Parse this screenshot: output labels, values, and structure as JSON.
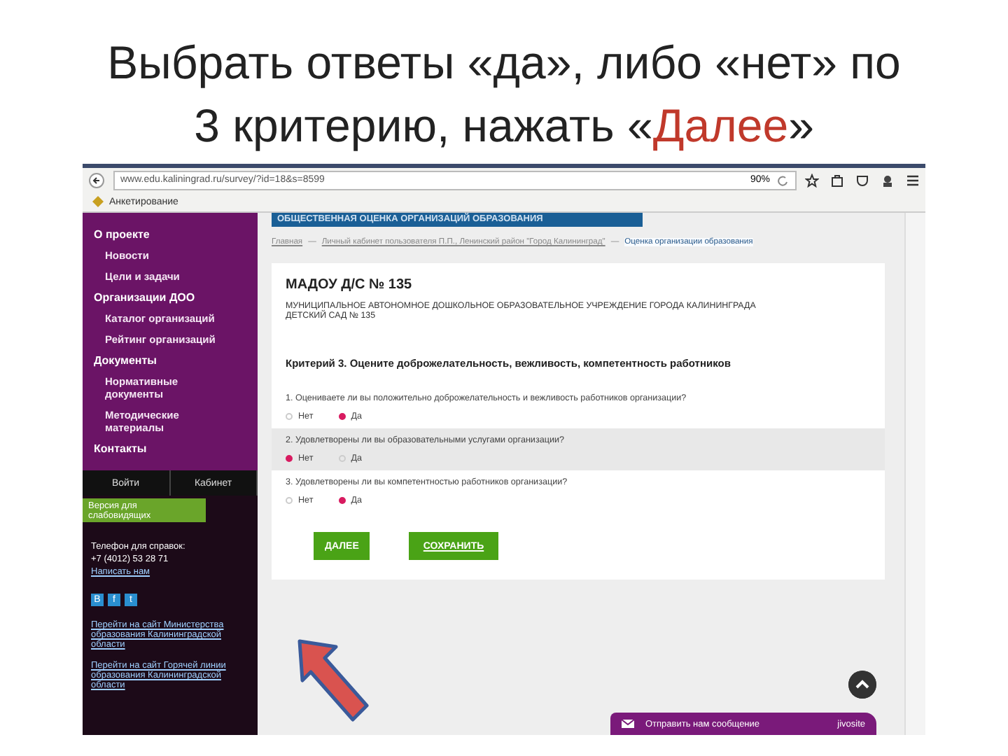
{
  "slide_title": [
    {
      "text": "Выбрать ответы «да», либо «нет» по",
      "highlight": false
    },
    {
      "text": "3 критерию, нажать «",
      "highlight": false
    },
    {
      "text": "Далее",
      "highlight": true
    },
    {
      "text": "»",
      "highlight": false
    }
  ],
  "browser": {
    "url": "www.edu.kaliningrad.ru/survey/?id=18&s=8599",
    "zoom": "90%",
    "bookmark": "Анкетирование"
  },
  "sidebar": {
    "sections": [
      {
        "label": "О проекте",
        "children": [
          {
            "label": "Новости"
          },
          {
            "label": "Цели и задачи"
          }
        ]
      },
      {
        "label": "Организации ДОО",
        "children": [
          {
            "label": "Каталог организаций"
          },
          {
            "label": "Рейтинг организаций"
          }
        ]
      },
      {
        "label": "Документы",
        "children": [
          {
            "label": "Нормативные документы"
          },
          {
            "label": "Методические материалы"
          }
        ]
      },
      {
        "label": "Контакты"
      }
    ],
    "buttons": [
      "Войти",
      "Кабинет"
    ],
    "accessibility_button": "Версия для слабовидящих",
    "phone_label": "Телефон для справок:",
    "phone": "+7 (4012) 53 28 71",
    "write_link": "Написать нам",
    "social": [
      "В",
      "f",
      "t"
    ],
    "links": [
      "Перейти на сайт Министерства образования Калининградской области",
      "Перейти на сайт Горячей линии образования Калининградской области"
    ]
  },
  "main": {
    "banner": "ОБЩЕСТВЕННАЯ ОЦЕНКА ОРГАНИЗАЦИЙ ОБРАЗОВАНИЯ",
    "breadcrumb_separator": "—",
    "breadcrumbs": [
      {
        "label": "Главная",
        "current": false
      },
      {
        "label": "Личный кабинет пользователя П.П., Ленинский район \"Город Калининград\"",
        "current": false
      },
      {
        "label": "Оценка организации образования",
        "current": true
      }
    ],
    "org_title": "МАДОУ Д/С № 135",
    "org_full_name": "МУНИЦИПАЛЬНОЕ АВТОНОМНОЕ ДОШКОЛЬНОЕ ОБРАЗОВАТЕЛЬНОЕ УЧРЕЖДЕНИЕ ГОРОДА КАЛИНИНГРАДА ДЕТСКИЙ САД № 135",
    "criterion": "Критерий 3. Оцените доброжелательность, вежливость, компетентность работников",
    "questions": [
      {
        "text": "1. Оцениваете ли вы положительно доброжелательность и вежливость работников организации?",
        "highlighted": false,
        "options": [
          {
            "label": "Нет",
            "selected": false
          },
          {
            "label": "Да",
            "selected": true
          }
        ]
      },
      {
        "text": "2. Удовлетворены ли вы образовательными услугами организации?",
        "highlighted": true,
        "options": [
          {
            "label": "Нет",
            "selected": true
          },
          {
            "label": "Да",
            "selected": false
          }
        ]
      },
      {
        "text": "3. Удовлетворены ли вы компетентностью работников организации?",
        "highlighted": false,
        "options": [
          {
            "label": "Нет",
            "selected": false
          },
          {
            "label": "Да",
            "selected": true
          }
        ]
      }
    ],
    "buttons": [
      "ДАЛЕЕ",
      "СОХРАНИТЬ"
    ],
    "chat_label": "Отправить нам сообщение",
    "chat_brand": "jivosite"
  }
}
